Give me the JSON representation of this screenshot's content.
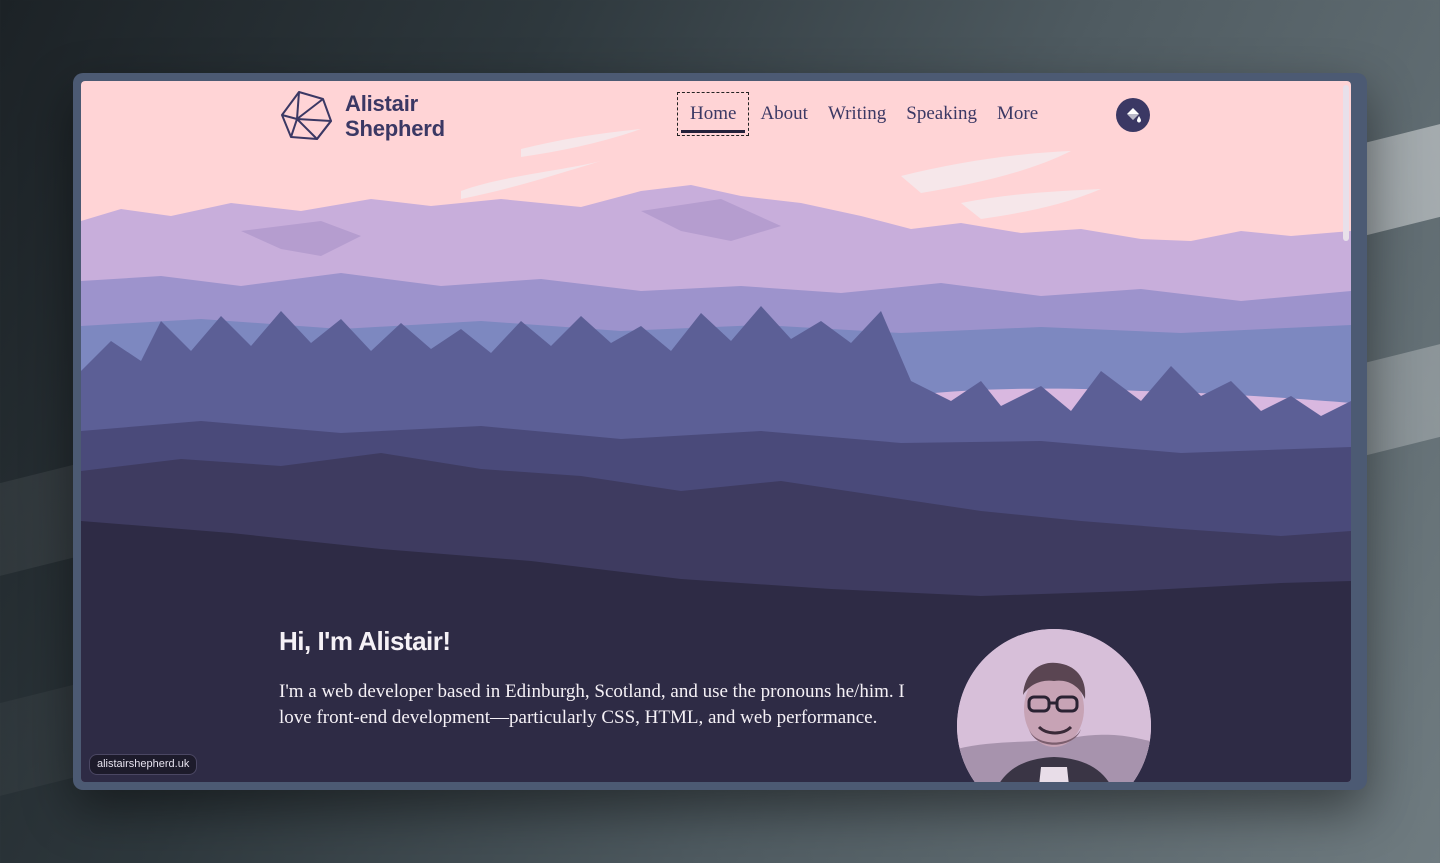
{
  "site": {
    "name_line1": "Alistair",
    "name_line2": "Shepherd"
  },
  "nav": {
    "items": [
      {
        "label": "Home",
        "active": true
      },
      {
        "label": "About"
      },
      {
        "label": "Writing"
      },
      {
        "label": "Speaking"
      },
      {
        "label": "More"
      }
    ],
    "theme_button_icon": "paint-bucket-icon"
  },
  "hero": {
    "heading": "Hi, I'm Alistair!",
    "body": "I'm a web developer based in Edinburgh, Scotland, and use the pronouns he/him. I love front-end development—particularly CSS, HTML, and web performance."
  },
  "status_url": "alistairshepherd.uk",
  "colors": {
    "sky": "#ffd4d6",
    "mountains_far": "#c8aedb",
    "hills_mid": "#7d88c0",
    "trees": "#5c5f96",
    "ground": "#2e2b45",
    "text_dark": "#3b3864",
    "text_light": "#f5f1f6"
  }
}
